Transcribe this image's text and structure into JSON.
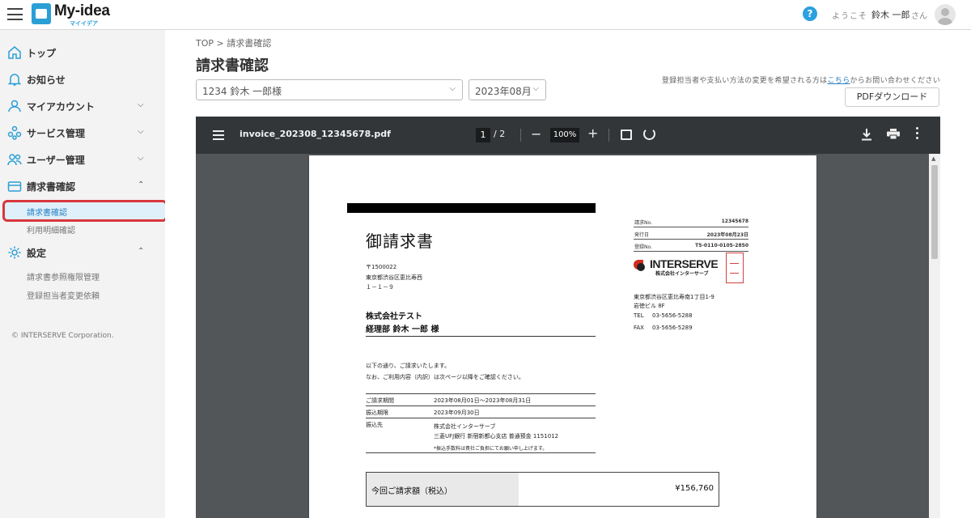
{
  "header": {
    "logo_text": "My-idea",
    "logo_sub": "マイイデア",
    "help": "?",
    "welcome": "ようこそ",
    "user_name": "鈴木 一郎",
    "suffix": "さん"
  },
  "sidebar": {
    "items": [
      {
        "label": "トップ",
        "icon": "home-icon"
      },
      {
        "label": "お知らせ",
        "icon": "bell-icon"
      },
      {
        "label": "マイアカウント",
        "icon": "user-icon",
        "chevron": "down"
      },
      {
        "label": "サービス管理",
        "icon": "services-icon",
        "chevron": "down"
      },
      {
        "label": "ユーザー管理",
        "icon": "users-icon",
        "chevron": "down"
      },
      {
        "label": "請求書確認",
        "icon": "card-icon",
        "chevron": "up"
      },
      {
        "label": "設定",
        "icon": "gear-icon",
        "chevron": "up"
      }
    ],
    "invoice_sub": [
      "請求書確認",
      "利用明細確認"
    ],
    "settings_sub": [
      "請求書参照権限管理",
      "登録担当者変更依頼"
    ],
    "copyright": "© INTERSERVE Corporation."
  },
  "main": {
    "breadcrumb": "TOP > 請求書確認",
    "title": "請求書確認",
    "customer_select": "1234 鈴木 一郎様",
    "month_select": "2023年08月",
    "notice_before": "登録担当者や支払い方法の変更を希望される方は",
    "notice_link": "こちら",
    "notice_after": "からお問い合わせください",
    "pdf_button": "PDFダウンロード"
  },
  "viewer": {
    "filename": "invoice_202308_12345678.pdf",
    "page_current": "1",
    "page_total": "/ 2",
    "zoom": "100%",
    "minus": "−",
    "plus": "+"
  },
  "invoice": {
    "title": "御請求書",
    "postal": "〒1500022",
    "address1": "東京都渋谷区恵比寿西",
    "address2": "１－１－９",
    "company": "株式会社テスト",
    "person": "経理部 鈴木 一郎 様",
    "meta": [
      {
        "k": "請求No.",
        "v": "12345678"
      },
      {
        "k": "発行日",
        "v": "2023年08月23日"
      },
      {
        "k": "登録No.",
        "v": "T5-0110-0105-2850"
      }
    ],
    "brand": "INTERSERVE",
    "brand_kana": "株式会社インターサーブ",
    "issuer_address1": "東京都渋谷区恵比寿南1丁目1-9",
    "issuer_address2": "岩徳ビル 8F",
    "tel_label": "TEL",
    "tel": "03-5656-5288",
    "fax_label": "FAX",
    "fax": "03-5656-5289",
    "intro1": "以下の通り、ご請求いたします。",
    "intro2": "なお、ご利用内容（内訳）は次ページ以降をご確認ください。",
    "period_label": "ご請求期間",
    "period": "2023年08月01日～2023年08月31日",
    "due_label": "振込期限",
    "due": "2023年09月30日",
    "bank_label": "振込先",
    "bank1": "株式会社インターサーブ",
    "bank2": "三菱UFJ銀行 新宿新都心支店 普通預金 1151012",
    "bank_note": "*振込手数料は貴社ご負担にてお願い申し上げます。",
    "amount_label": "今回ご請求額（税込）",
    "amount": "¥156,760"
  }
}
